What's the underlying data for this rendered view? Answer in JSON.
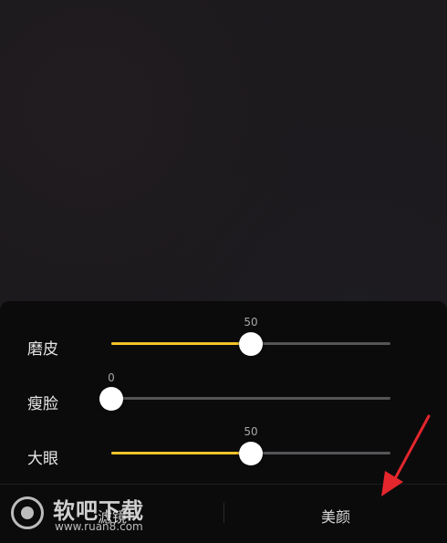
{
  "sliders": [
    {
      "label": "磨皮",
      "value": "50",
      "level_percent": 50
    },
    {
      "label": "瘦脸",
      "value": "0",
      "level_percent": 0
    },
    {
      "label": "大眼",
      "value": "50",
      "level_percent": 50
    }
  ],
  "tabs": [
    {
      "label": "滤镜"
    },
    {
      "label": "美颜"
    }
  ],
  "watermark": {
    "title": "软吧下载",
    "url": "www.ruan8.com"
  },
  "colors": {
    "accent": "#f2c32a",
    "track": "#555558",
    "panel": "#0b0b0c",
    "arrow": "#e5262d"
  }
}
